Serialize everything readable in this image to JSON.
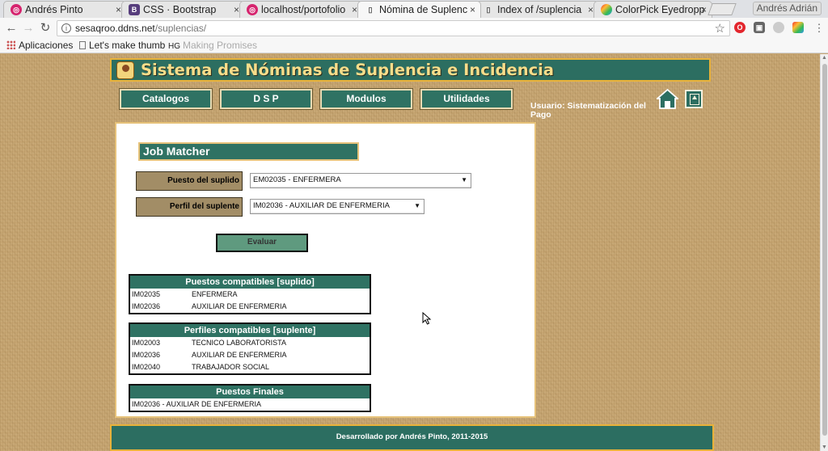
{
  "browser": {
    "tabs": [
      {
        "label": "Andrés Pinto",
        "favicon": "instagram-icon",
        "favicon_color": "#d6246e"
      },
      {
        "label": "CSS · Bootstrap",
        "favicon": "bootstrap-icon",
        "favicon_color": "#563d7c"
      },
      {
        "label": "localhost/portofolio",
        "favicon": "instagram-icon",
        "favicon_color": "#d6246e"
      },
      {
        "label": "Nómina de Suplenc",
        "favicon": "page-icon",
        "active": true
      },
      {
        "label": "Index of /suplencia",
        "favicon": "page-icon"
      },
      {
        "label": "ColorPick Eyedropp",
        "favicon": "colorpick-icon"
      }
    ],
    "tab_close_glyph": "×",
    "profile_name": "Andrés Adrián",
    "url_host": "sesaqroo.ddns.net",
    "url_path": "/suplencias/",
    "bookmarks": {
      "apps": "Aplicaciones",
      "item1": "Let's make thumb",
      "item2_prefix": "HG",
      "item2": "Making Promises"
    }
  },
  "app": {
    "title": "Sistema de Nóminas de Suplencia e Incidencia",
    "menu": [
      "Catalogos",
      "D S P",
      "Modulos",
      "Utilidades"
    ],
    "user_label": "Usuario: Sistematización del Pago",
    "accent_color": "#2c6e61",
    "border_color": "#e8b23a"
  },
  "form": {
    "title": "Job Matcher",
    "puesto_label": "Puesto del suplido",
    "puesto_value": "EM02035 - ENFERMERA",
    "perfil_label": "Perfil del suplente",
    "perfil_value": "IM02036 - AUXILIAR DE ENFERMERIA",
    "evaluate_label": "Evaluar"
  },
  "results": {
    "puestos": {
      "header": "Puestos compatibles [suplido]",
      "rows": [
        {
          "code": "IM02035",
          "name": "ENFERMERA"
        },
        {
          "code": "IM02036",
          "name": "AUXILIAR DE ENFERMERIA"
        }
      ]
    },
    "perfiles": {
      "header": "Perfiles compatibles [suplente]",
      "rows": [
        {
          "code": "IM02003",
          "name": "TECNICO LABORATORISTA"
        },
        {
          "code": "IM02036",
          "name": "AUXILIAR DE ENFERMERIA"
        },
        {
          "code": "IM02040",
          "name": "TRABAJADOR SOCIAL"
        }
      ]
    },
    "finales": {
      "header": "Puestos Finales",
      "rows": [
        {
          "text": "IM02036 - AUXILIAR DE ENFERMERIA"
        }
      ]
    }
  },
  "footer": "Desarrollado por Andrés Pinto, 2011-2015"
}
